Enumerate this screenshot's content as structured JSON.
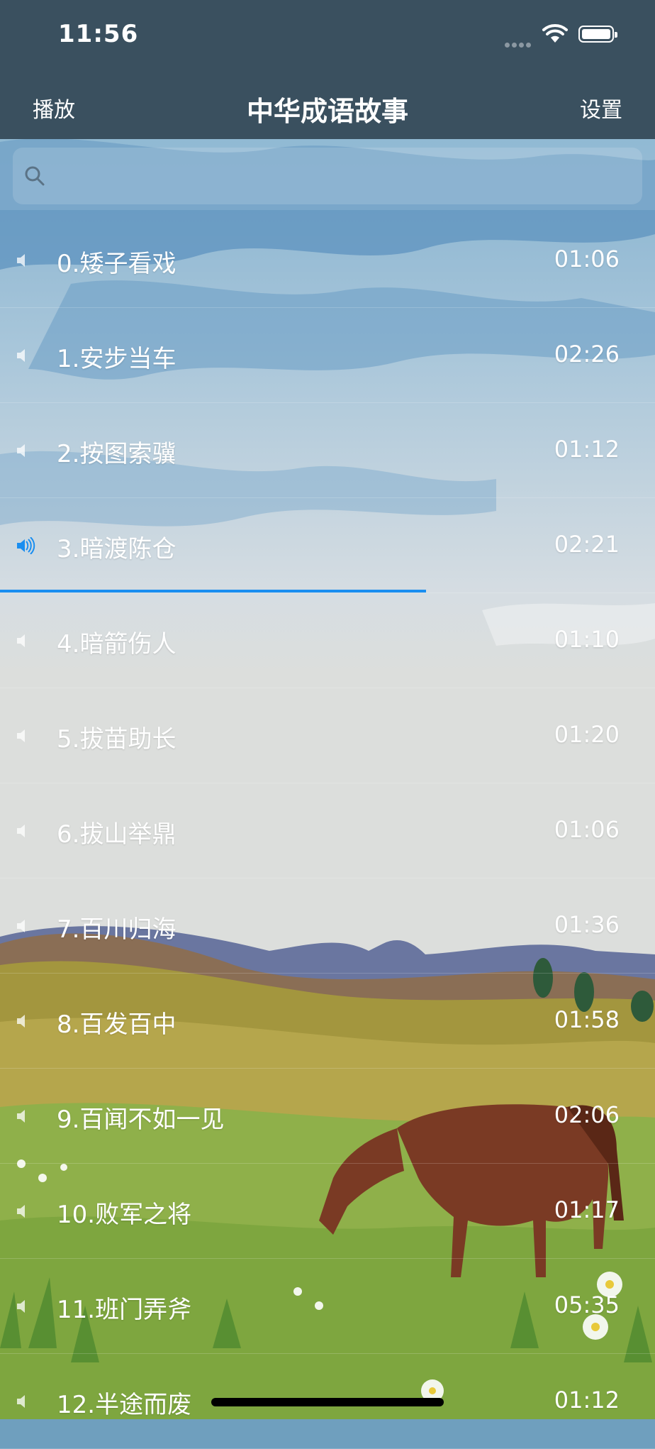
{
  "status_bar": {
    "time": "11:56"
  },
  "nav": {
    "left": "播放",
    "title": "中华成语故事",
    "right": "设置"
  },
  "search": {
    "placeholder": ""
  },
  "playing_index": 3,
  "playback_progress": 0.65,
  "accent_color": "#1a8ef0",
  "list": [
    {
      "title": "0.矮子看戏",
      "duration": "01:06"
    },
    {
      "title": "1.安步当车",
      "duration": "02:26"
    },
    {
      "title": "2.按图索骥",
      "duration": "01:12"
    },
    {
      "title": "3.暗渡陈仓",
      "duration": "02:21"
    },
    {
      "title": "4.暗箭伤人",
      "duration": "01:10"
    },
    {
      "title": "5.拔苗助长",
      "duration": "01:20"
    },
    {
      "title": "6.拔山举鼎",
      "duration": "01:06"
    },
    {
      "title": "7.百川归海",
      "duration": "01:36"
    },
    {
      "title": "8.百发百中",
      "duration": "01:58"
    },
    {
      "title": "9.百闻不如一见",
      "duration": "02:06"
    },
    {
      "title": "10.败军之将",
      "duration": "01:17"
    },
    {
      "title": "11.班门弄斧",
      "duration": "05:35"
    },
    {
      "title": "12.半途而废",
      "duration": "01:12"
    }
  ]
}
